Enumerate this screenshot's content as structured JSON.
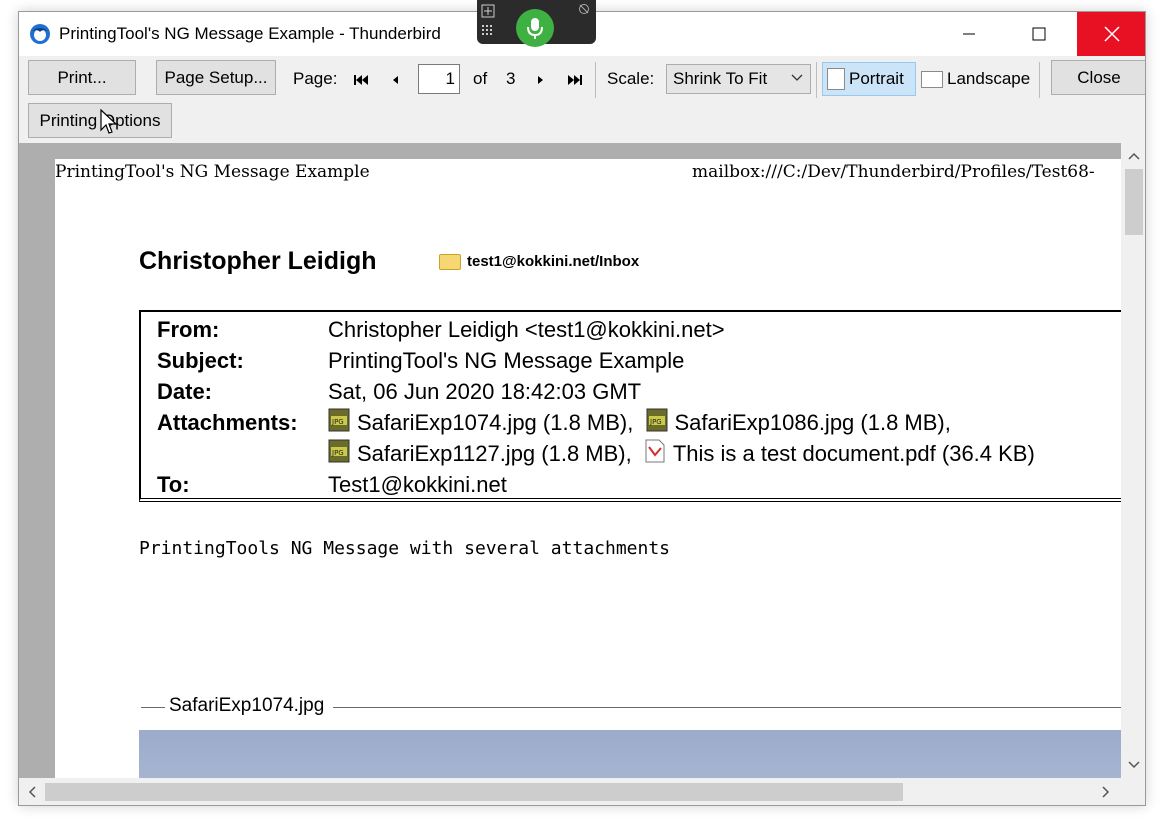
{
  "window": {
    "title": "PrintingTool's NG Message Example - Thunderbird"
  },
  "toolbar": {
    "print_label": "Print...",
    "page_setup_label": "Page Setup...",
    "page_label": "Page:",
    "page_current": "1",
    "of_label": "of",
    "page_total": "3",
    "scale_label": "Scale:",
    "scale_value": "Shrink To Fit",
    "portrait_label": "Portrait",
    "landscape_label": "Landscape",
    "close_label": "Close",
    "printing_options_label": "Printing Options"
  },
  "page": {
    "header_left": "PrintingTool's NG Message Example",
    "header_right": "mailbox:///C:/Dev/Thunderbird/Profiles/Test68-",
    "sender_name": "Christopher Leidigh",
    "folder": "test1@kokkini.net/Inbox",
    "headers": {
      "from_key": "From:",
      "from_val": "Christopher Leidigh <test1@kokkini.net>",
      "subject_key": "Subject:",
      "subject_val": "PrintingTool's NG Message Example",
      "date_key": "Date:",
      "date_val": "Sat, 06 Jun 2020 18:42:03 GMT",
      "attachments_key": "Attachments:",
      "attachments": [
        "SafariExp1074.jpg (1.8 MB),",
        "SafariExp1086.jpg (1.8 MB),",
        "SafariExp1127.jpg (1.8 MB),",
        "This is a test document.pdf (36.4 KB)"
      ],
      "to_key": "To:",
      "to_val": "Test1@kokkini.net"
    },
    "body": "PrintingTools NG Message with several attachments",
    "attachment_separator": "SafariExp1074.jpg"
  },
  "colors": {
    "close_button": "#e81123",
    "mic": "#3fb042",
    "selected_orientation": "#cce4f7"
  }
}
